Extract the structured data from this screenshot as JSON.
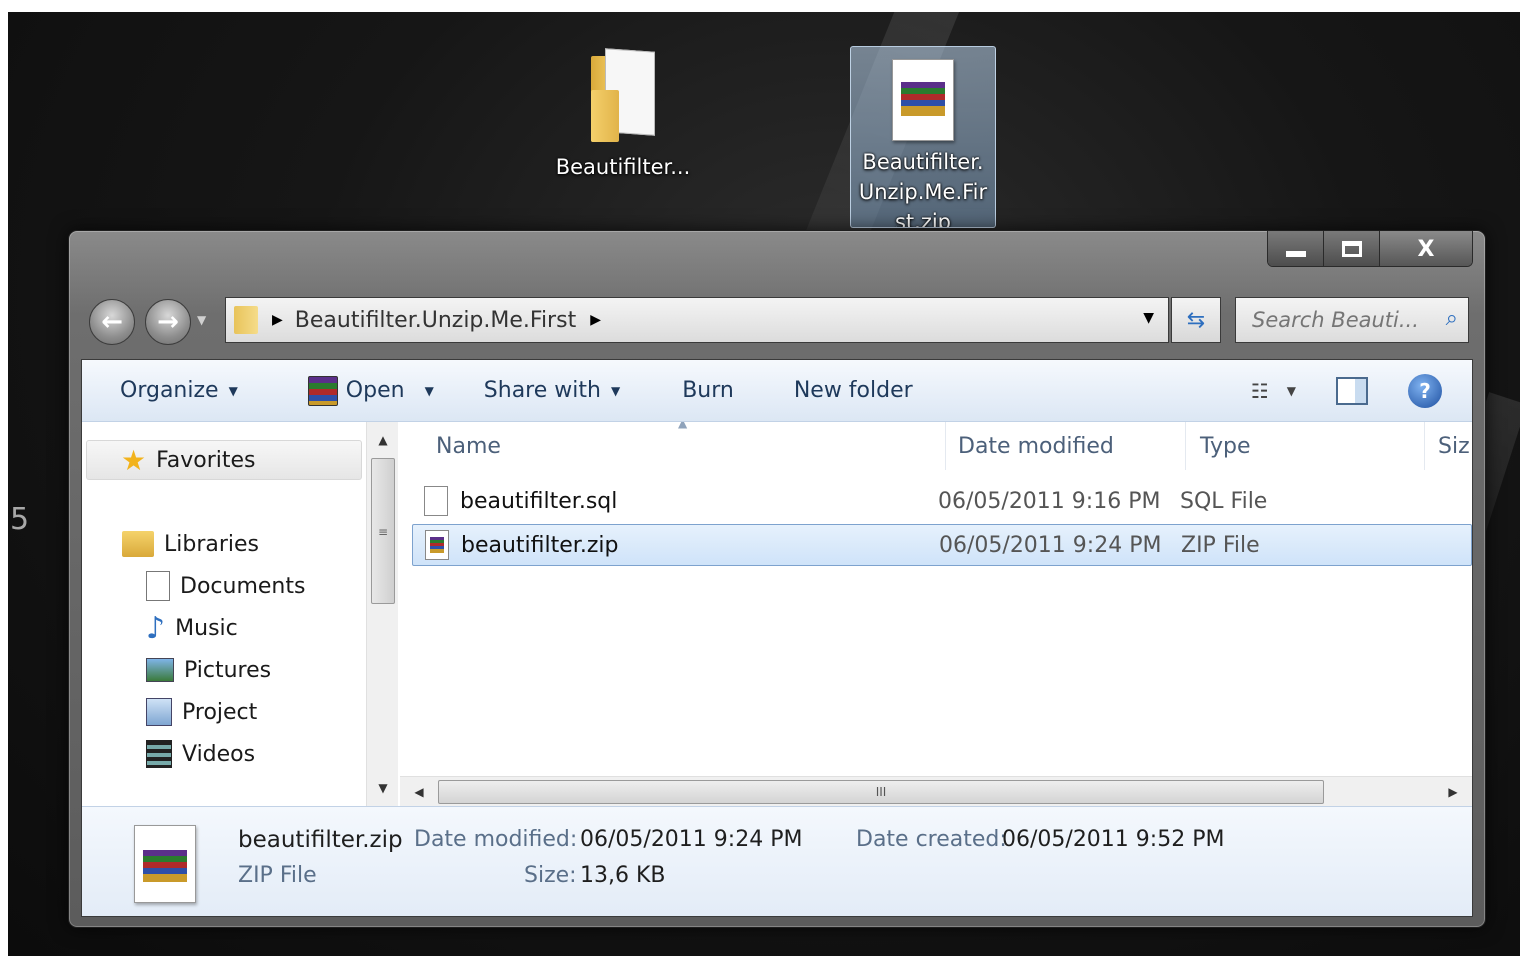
{
  "desktop": {
    "edge_number": "5",
    "icons": [
      {
        "label": "Beautifilter...",
        "kind": "folder"
      },
      {
        "label": "Beautifilter.Unzip.Me.First.zip",
        "kind": "zip"
      }
    ]
  },
  "window": {
    "controls": {
      "minimize": "▁",
      "maximize": "▢",
      "close": "X"
    },
    "breadcrumb": "Beautifilter.Unzip.Me.First",
    "search_placeholder": "Search Beauti...",
    "toolbar": {
      "organize": "Organize",
      "open": "Open",
      "share_with": "Share with",
      "burn": "Burn",
      "new_folder": "New folder"
    },
    "navigation": {
      "favorites": "Favorites",
      "libraries": "Libraries",
      "items": [
        "Documents",
        "Music",
        "Pictures",
        "Project",
        "Videos"
      ]
    },
    "columns": {
      "name": "Name",
      "date_modified": "Date modified",
      "type": "Type",
      "size": "Siz"
    },
    "files": [
      {
        "name": "beautifilter.sql",
        "date": "06/05/2011 9:16 PM",
        "type": "SQL File",
        "icon": "sql-file-icon",
        "selected": false
      },
      {
        "name": "beautifilter.zip",
        "date": "06/05/2011 9:24 PM",
        "type": "ZIP File",
        "icon": "zip-file-icon",
        "selected": true
      }
    ],
    "details": {
      "filename": "beautifilter.zip",
      "filetype": "ZIP File",
      "date_modified_label": "Date modified:",
      "date_modified": "06/05/2011 9:24 PM",
      "size_label": "Size:",
      "size": "13,6 KB",
      "date_created_label": "Date created:",
      "date_created": "06/05/2011 9:52 PM"
    }
  }
}
